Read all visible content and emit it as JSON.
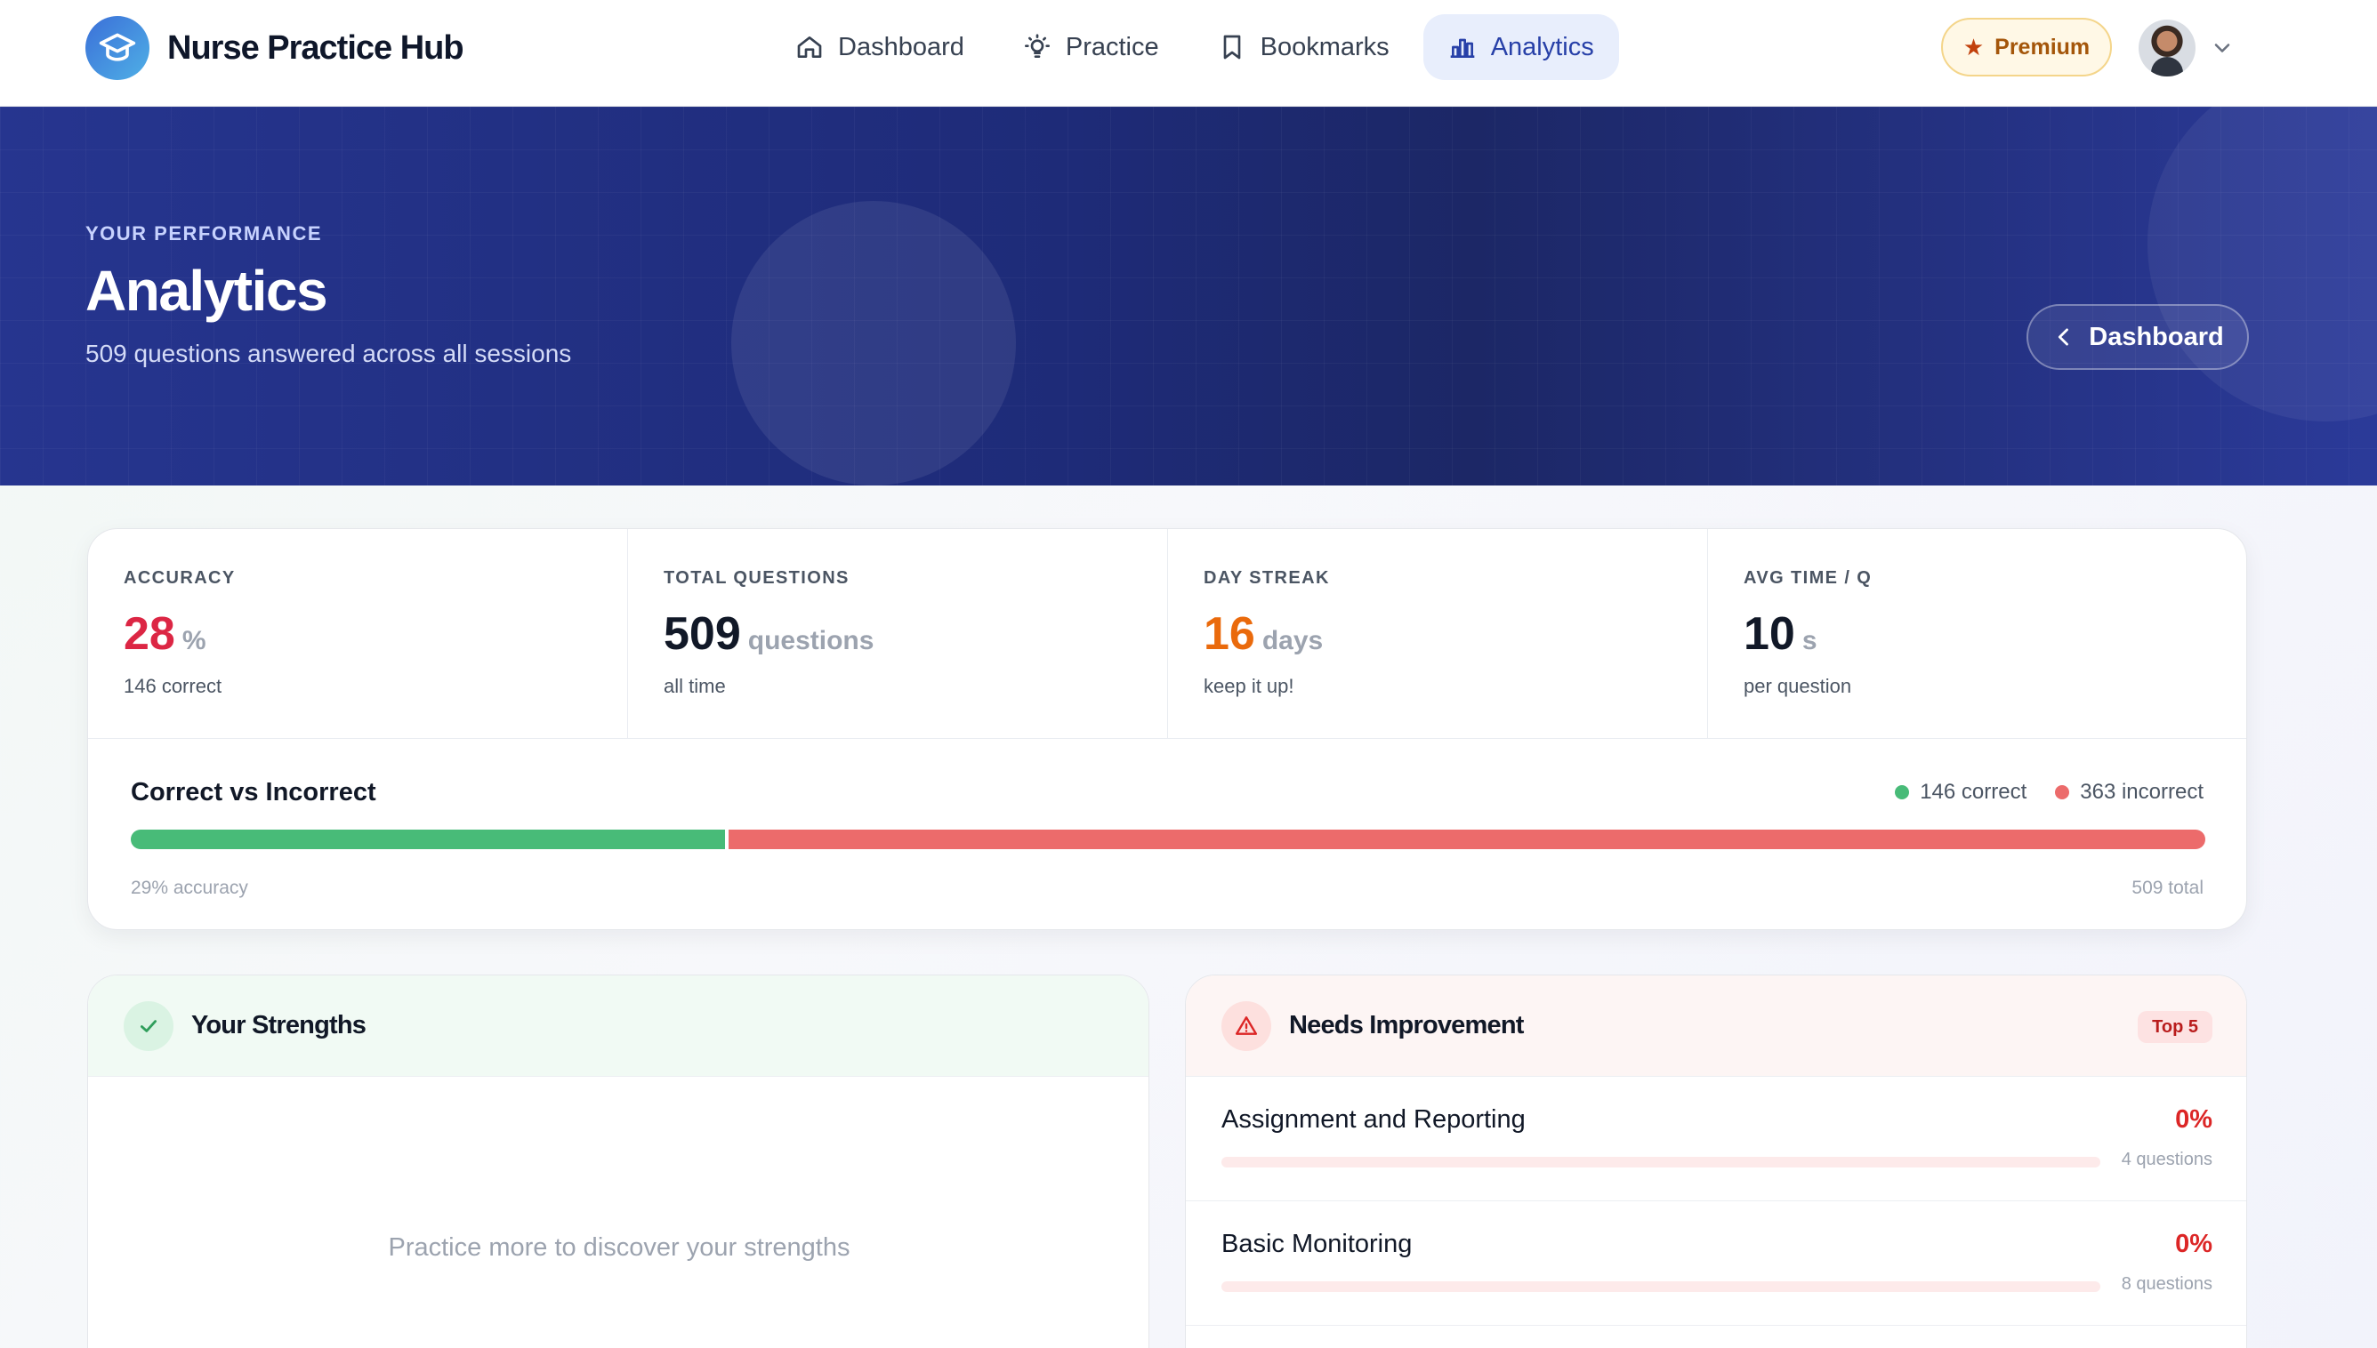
{
  "brand": {
    "name": "Nurse Practice Hub"
  },
  "nav": {
    "items": [
      {
        "label": "Dashboard",
        "icon": "home-icon"
      },
      {
        "label": "Practice",
        "icon": "lightbulb-icon"
      },
      {
        "label": "Bookmarks",
        "icon": "bookmark-icon"
      },
      {
        "label": "Analytics",
        "icon": "bar-chart-icon",
        "active": true
      }
    ],
    "premium_label": "Premium"
  },
  "hero": {
    "eyebrow": "YOUR PERFORMANCE",
    "title": "Analytics",
    "subtitle": "509 questions answered across all sessions",
    "back_button": "Dashboard"
  },
  "stats": [
    {
      "label": "ACCURACY",
      "value": "28",
      "unit": "%",
      "note": "146 correct",
      "color": "#dc2644"
    },
    {
      "label": "TOTAL QUESTIONS",
      "value": "509",
      "unit": "questions",
      "note": "all time",
      "color": "#111827"
    },
    {
      "label": "DAY STREAK",
      "value": "16",
      "unit": "days",
      "note": "keep it up!",
      "color": "#ea6a0c"
    },
    {
      "label": "AVG TIME / Q",
      "value": "10",
      "unit": "s",
      "note": "per question",
      "color": "#111827"
    }
  ],
  "correct_vs_incorrect": {
    "title": "Correct vs Incorrect",
    "correct_label": "146 correct",
    "incorrect_label": "363 incorrect",
    "correct": 146,
    "incorrect": 363,
    "accuracy_label": "29% accuracy",
    "total_label": "509 total",
    "colors": {
      "correct": "#48bb78",
      "incorrect": "#ec6b6b"
    }
  },
  "strengths": {
    "title": "Your Strengths",
    "empty_message": "Practice more to discover your strengths"
  },
  "improvement": {
    "title": "Needs Improvement",
    "badge": "Top 5",
    "items": [
      {
        "name": "Assignment and Reporting",
        "percent_label": "0%",
        "percent": 0,
        "count_label": "4 questions"
      },
      {
        "name": "Basic Monitoring",
        "percent_label": "0%",
        "percent": 0,
        "count_label": "8 questions"
      }
    ]
  }
}
